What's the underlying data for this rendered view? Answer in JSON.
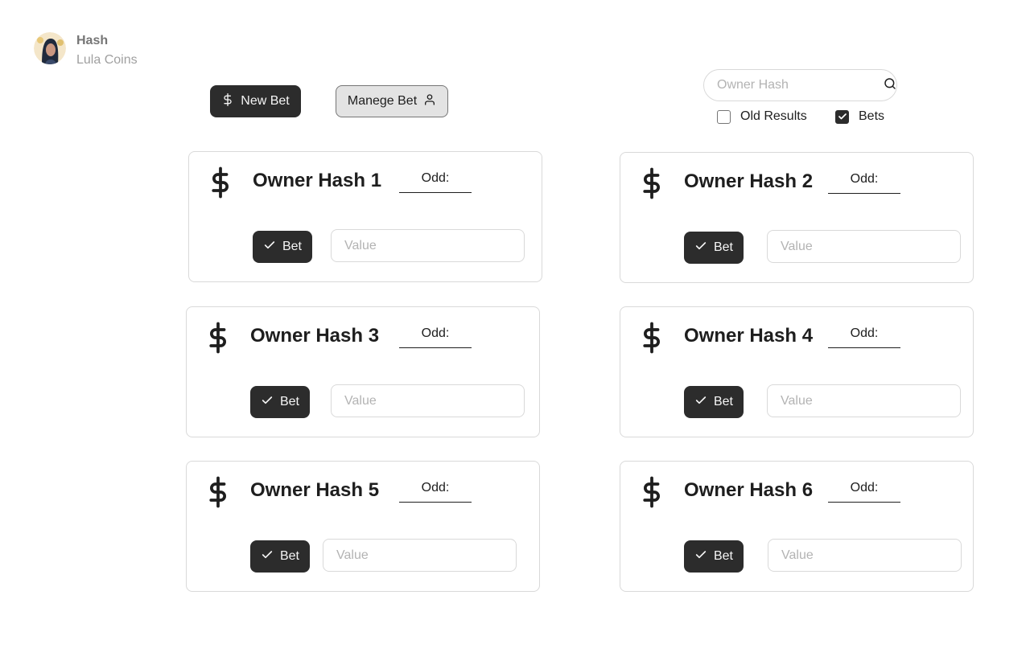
{
  "profile": {
    "name": "Hash",
    "subtitle": "Lula Coins"
  },
  "toolbar": {
    "new_bet_label": "New Bet",
    "manage_bet_label": "Manege Bet"
  },
  "search": {
    "placeholder": "Owner Hash",
    "value": ""
  },
  "filters": {
    "old_results": {
      "label": "Old Results",
      "checked": false
    },
    "bets": {
      "label": "Bets",
      "checked": true
    }
  },
  "cards": [
    {
      "owner": "Owner Hash 1",
      "odd_label": "Odd:",
      "bet_label": "Bet",
      "value_placeholder": "Value"
    },
    {
      "owner": "Owner Hash 2",
      "odd_label": "Odd:",
      "bet_label": "Bet",
      "value_placeholder": "Value"
    },
    {
      "owner": "Owner Hash 3",
      "odd_label": "Odd:",
      "bet_label": "Bet",
      "value_placeholder": "Value"
    },
    {
      "owner": "Owner Hash 4",
      "odd_label": "Odd:",
      "bet_label": "Bet",
      "value_placeholder": "Value"
    },
    {
      "owner": "Owner Hash 5",
      "odd_label": "Odd:",
      "bet_label": "Bet",
      "value_placeholder": "Value"
    },
    {
      "owner": "Owner Hash 6",
      "odd_label": "Odd:",
      "bet_label": "Bet",
      "value_placeholder": "Value"
    }
  ],
  "icons": {
    "dollar": "dollar-icon",
    "user": "user-icon",
    "search": "search-icon",
    "check": "check-icon"
  },
  "colors": {
    "primary": "#2c2c2c",
    "secondary_bg": "#e3e3e3",
    "border": "#d9d9d9"
  }
}
